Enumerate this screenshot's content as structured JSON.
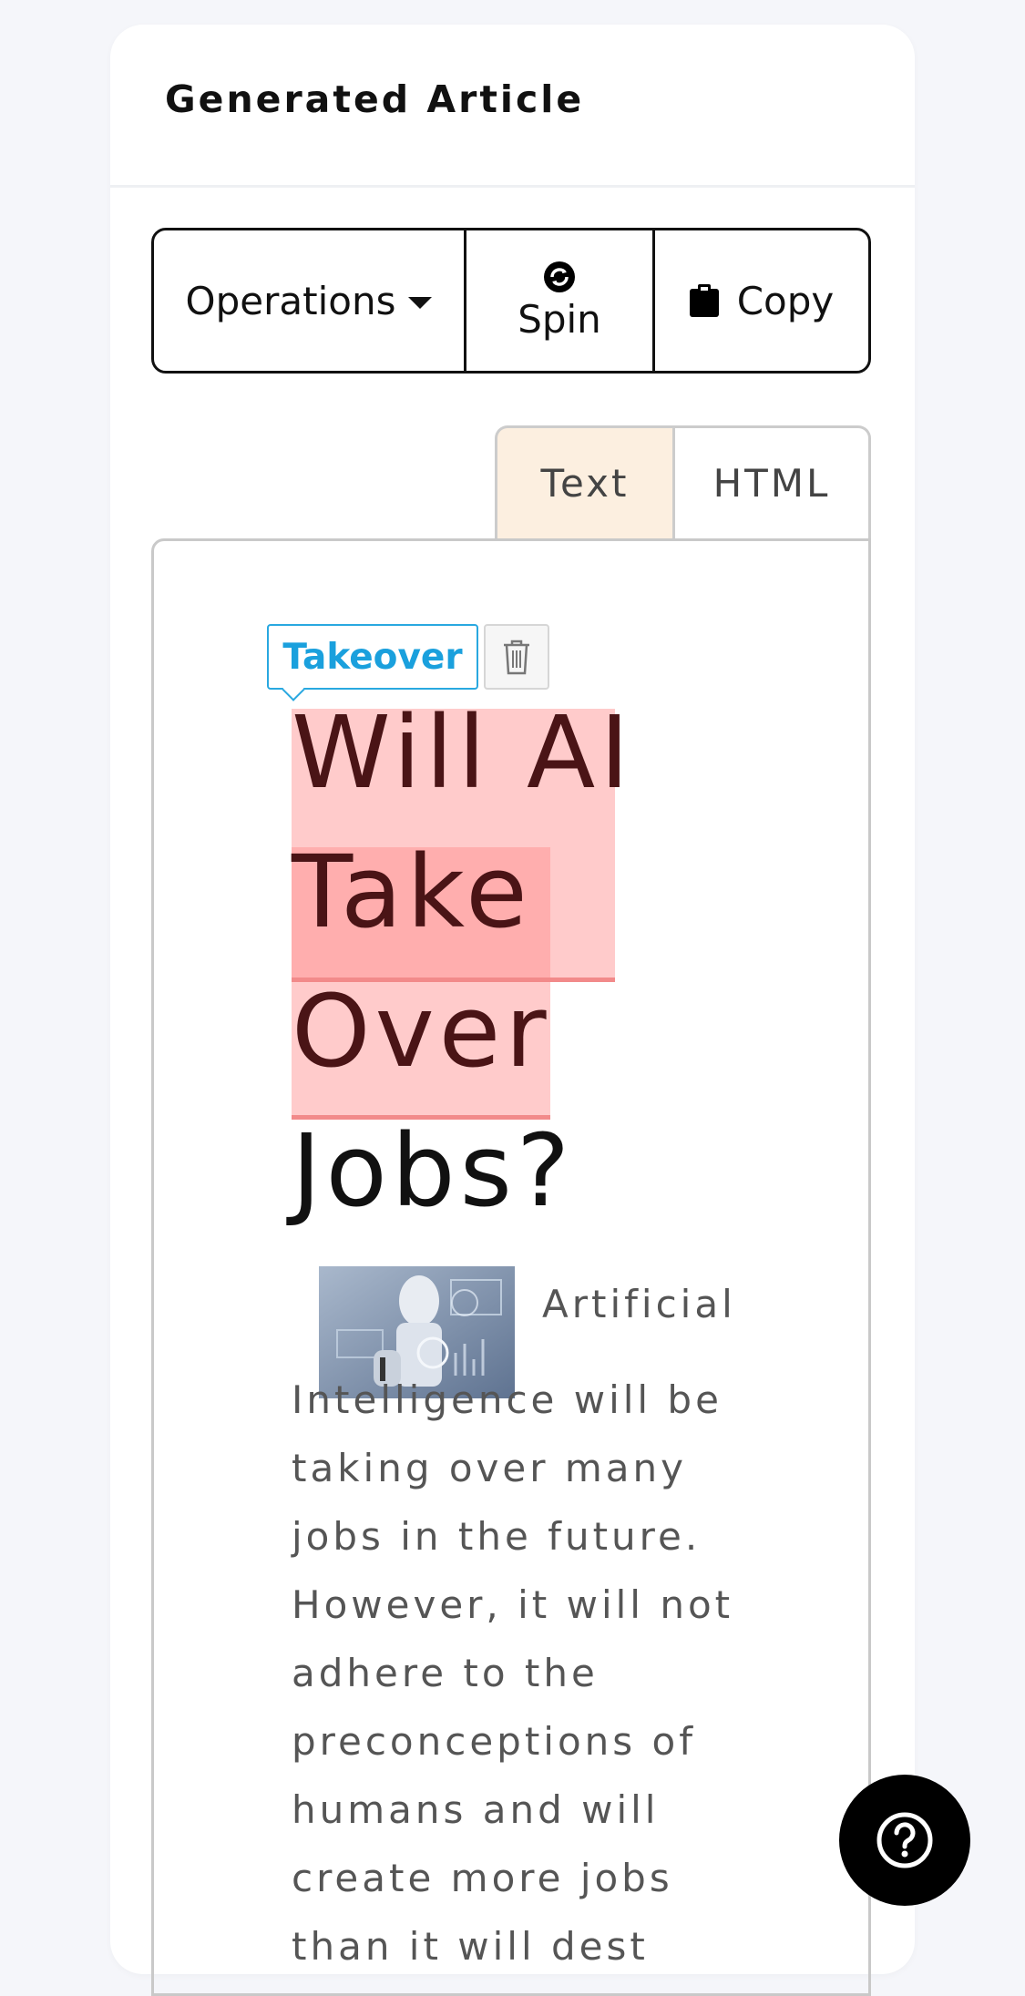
{
  "card": {
    "title": "Generated Article"
  },
  "toolbar": {
    "operations_label": "Operations",
    "spin_label": "Spin",
    "copy_label": "Copy"
  },
  "tabs": [
    {
      "label": "Text",
      "active": true
    },
    {
      "label": "HTML",
      "active": false
    }
  ],
  "editor": {
    "takeover_label": "Takeover",
    "heading_words": [
      "Will AI",
      "Take",
      "Over",
      "Jobs?"
    ],
    "highlighted_words": [
      "Will AI",
      "Take",
      "Over"
    ],
    "image_icon": "robot-thumbnail-image",
    "body_lead": "Artificial",
    "body_rest": "Intelligence will be taking over many jobs in the future. However, it will not adhere to the preconceptions of humans and will create more jobs than it will dest"
  },
  "colors": {
    "highlight": "#ffa0a0",
    "highlight_text": "#4a1416",
    "takeover_blue": "#1aa0dd",
    "active_tab": "#fcefe0"
  },
  "icons": {
    "spin": "spin-icon",
    "copy": "clipboard-icon",
    "delete": "trash-icon",
    "help": "question-icon",
    "dropdown": "caret-down-icon"
  }
}
